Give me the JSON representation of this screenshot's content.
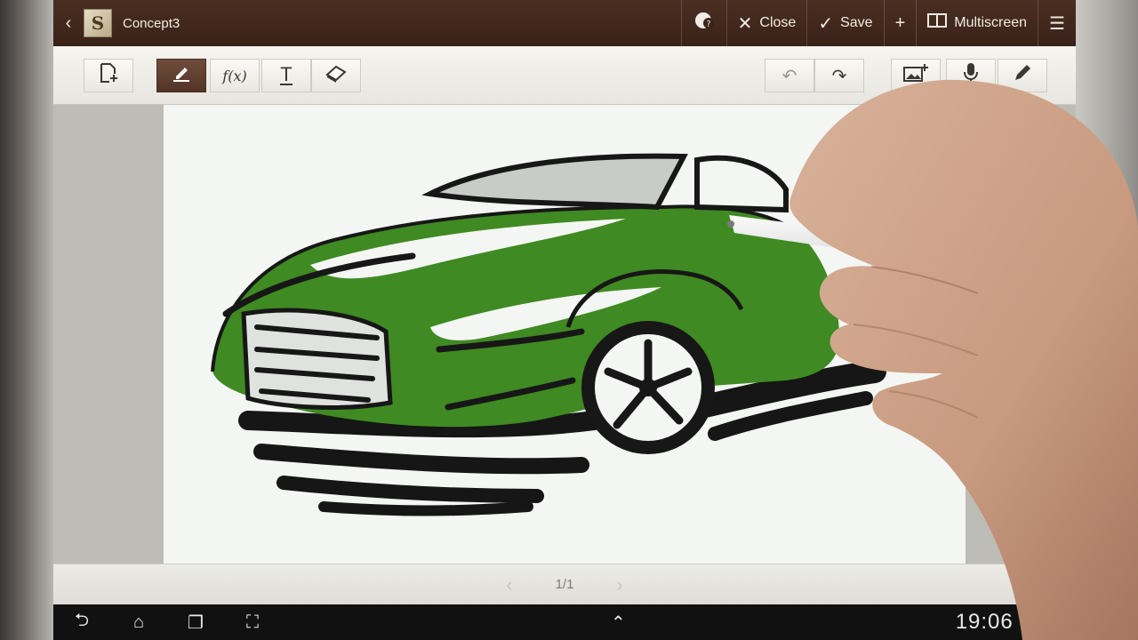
{
  "titlebar": {
    "back_icon": "chevron-left-icon",
    "logo_letter": "S",
    "doc_title": "Concept3",
    "items": [
      {
        "icon": "globe-help-icon",
        "label": ""
      },
      {
        "icon": "close-icon",
        "label": "Close"
      },
      {
        "icon": "check-icon",
        "label": "Save"
      },
      {
        "icon": "plus-icon",
        "label": ""
      },
      {
        "icon": "multiscreen-icon",
        "label": "Multiscreen"
      },
      {
        "icon": "menu-icon",
        "label": ""
      }
    ]
  },
  "toolbar": {
    "left_tools": [
      "page-add-icon",
      "pen-icon",
      "formula-icon",
      "text-icon",
      "eraser-icon"
    ],
    "formula_label": "f(x)",
    "text_label": "T",
    "right_tools": [
      "undo-icon",
      "redo-icon",
      "insert-image-icon",
      "microphone-icon",
      "pen-settings-icon"
    ],
    "active_tool": "pen-icon"
  },
  "pagenav": {
    "current": "1/1"
  },
  "statusbar": {
    "time": "19:06"
  },
  "colors": {
    "titlebar": "#3a2219",
    "sketch_green": "#3f8a22",
    "page": "#f4f6f4"
  }
}
